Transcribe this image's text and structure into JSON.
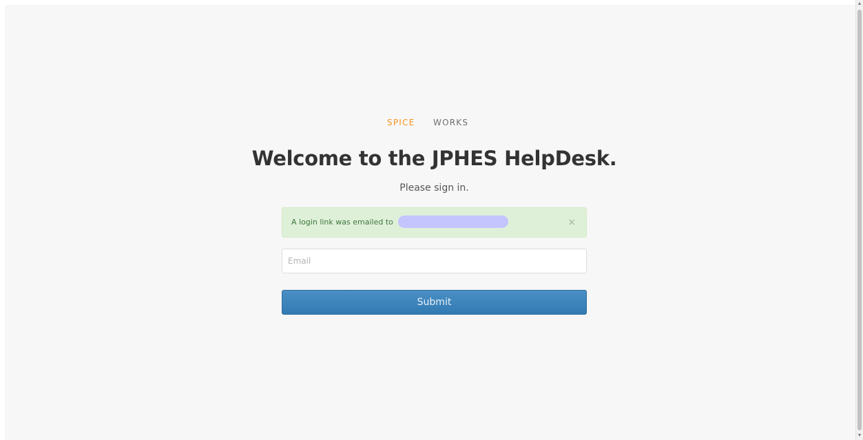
{
  "brand": {
    "logo_text_orange": "SPICE",
    "logo_text_gray": "WORKS",
    "orange_color": "#f7931e",
    "gray_color": "#6d6e71"
  },
  "page": {
    "title": "Welcome to the JPHES HelpDesk.",
    "subtitle": "Please sign in."
  },
  "alert": {
    "message": "A login link was emailed to",
    "close_symbol": "×",
    "background_color": "#dff0d8",
    "text_color": "#3c763d"
  },
  "form": {
    "email_placeholder": "Email",
    "email_value": "",
    "submit_label": "Submit",
    "submit_color": "#3a84bb"
  },
  "scrollbar": {
    "up_arrow": "▲",
    "down_arrow": "▼"
  }
}
